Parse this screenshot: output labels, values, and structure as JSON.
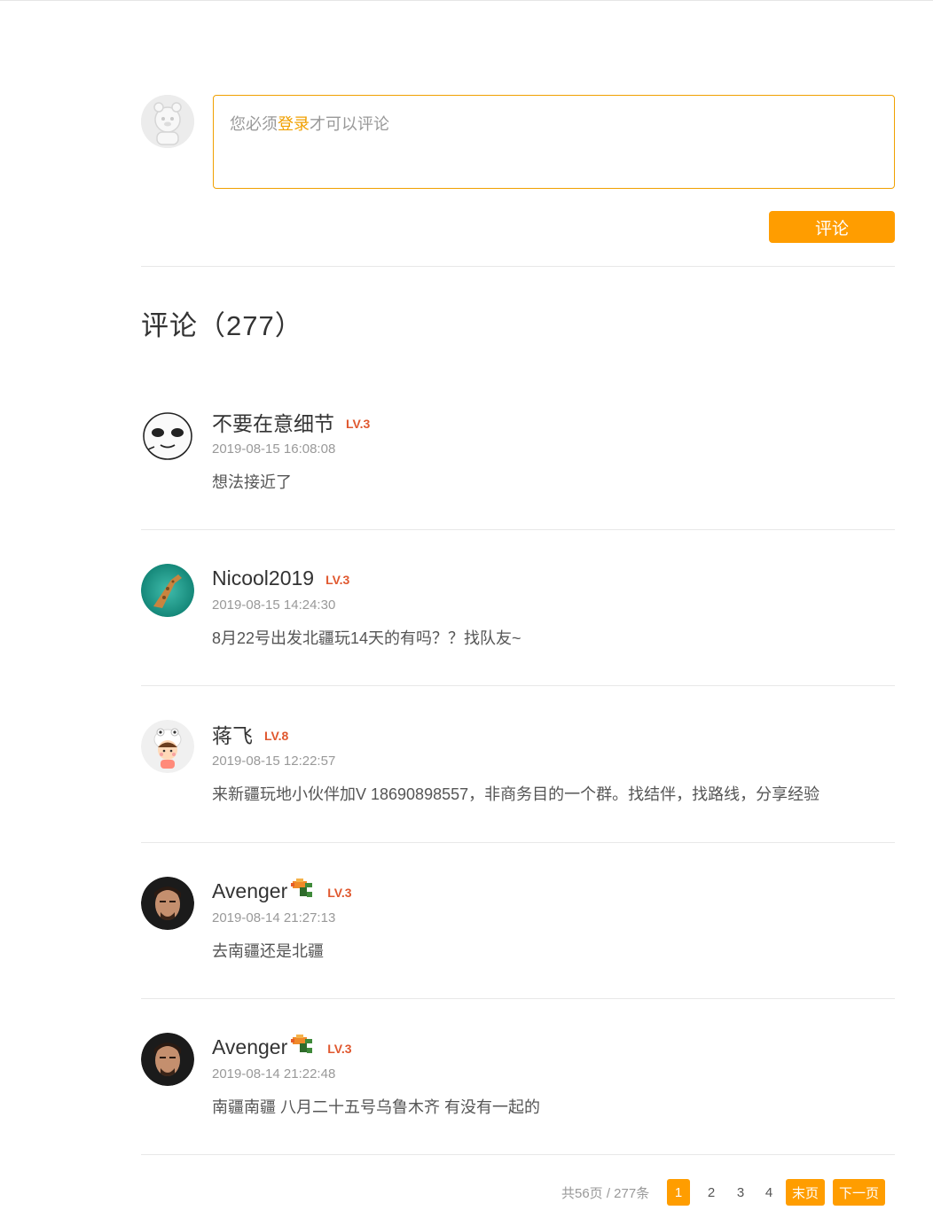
{
  "composer": {
    "placeholder_prefix": "您必须",
    "login_link": "登录",
    "placeholder_suffix": "才可以评论",
    "submit_label": "评论"
  },
  "section": {
    "title": "评论（277）"
  },
  "comments": [
    {
      "username": "不要在意细节",
      "level": "LV.3",
      "time": "2019-08-15 16:08:08",
      "text": "想法接近了",
      "avatar": "cartoon-face-icon"
    },
    {
      "username": "Nicool2019",
      "level": "LV.3",
      "time": "2019-08-15 14:24:30",
      "text": "8月22号出发北疆玩14天的有吗？？找队友~",
      "avatar": "giraffe-photo"
    },
    {
      "username": "蒋飞",
      "level": "LV.8",
      "time": "2019-08-15 12:22:57",
      "text": "来新疆玩地小伙伴加V 18690898557，非商务目的一个群。找结伴，找路线，分享经验",
      "avatar": "cartoon-child-icon"
    },
    {
      "username": "Avenger",
      "level": "LV.3",
      "time": "2019-08-14 21:27:13",
      "text": "去南疆还是北疆",
      "avatar": "man-portrait-photo",
      "badge": "pixel-gun-icon"
    },
    {
      "username": "Avenger",
      "level": "LV.3",
      "time": "2019-08-14 21:22:48",
      "text": "南疆南疆 八月二十五号乌鲁木齐 有没有一起的",
      "avatar": "man-portrait-photo",
      "badge": "pixel-gun-icon"
    }
  ],
  "pager": {
    "info": "共56页 / 277条",
    "pages": [
      "1",
      "2",
      "3",
      "4"
    ],
    "current": "1",
    "last_label": "末页",
    "next_label": "下一页"
  },
  "colors": {
    "accent": "#ff9d00",
    "level": "#e0582f",
    "border": "#f0a000"
  }
}
